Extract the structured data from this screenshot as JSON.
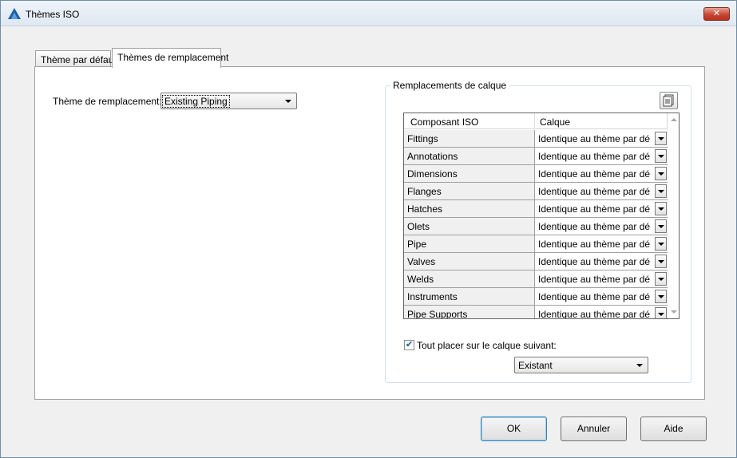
{
  "window": {
    "title": "Thèmes ISO",
    "close_label": "✕"
  },
  "tabs": [
    {
      "label": "Thème par défaut",
      "active": false
    },
    {
      "label": "Thèmes de remplacement",
      "active": true
    }
  ],
  "override_theme": {
    "label": "Thème de remplacement:",
    "value": "Existing Piping"
  },
  "layer_overrides": {
    "group_title": "Remplacements de calque",
    "columns": [
      "Composant ISO",
      "Calque"
    ],
    "rows": [
      {
        "component": "Fittings",
        "layer": "Identique au thème par défaut"
      },
      {
        "component": "Annotations",
        "layer": "Identique au thème par défaut"
      },
      {
        "component": "Dimensions",
        "layer": "Identique au thème par défaut"
      },
      {
        "component": "Flanges",
        "layer": "Identique au thème par défaut"
      },
      {
        "component": "Hatches",
        "layer": "Identique au thème par défaut"
      },
      {
        "component": "Olets",
        "layer": "Identique au thème par défaut"
      },
      {
        "component": "Pipe",
        "layer": "Identique au thème par défaut"
      },
      {
        "component": "Valves",
        "layer": "Identique au thème par défaut"
      },
      {
        "component": "Welds",
        "layer": "Identique au thème par défaut"
      },
      {
        "component": "Instruments",
        "layer": "Identique au thème par défaut"
      },
      {
        "component": "Pipe Supports",
        "layer": "Identique au thème par défaut"
      }
    ],
    "place_all": {
      "label": "Tout placer sur le calque suivant:",
      "checked": true,
      "check_glyph": "✔"
    },
    "target_layer": "Existant"
  },
  "footer": {
    "ok_label": "OK",
    "cancel_label": "Annuler",
    "help_label": "Aide"
  },
  "colors": {
    "accent": "#3c7fb1",
    "close": "#c74634"
  }
}
